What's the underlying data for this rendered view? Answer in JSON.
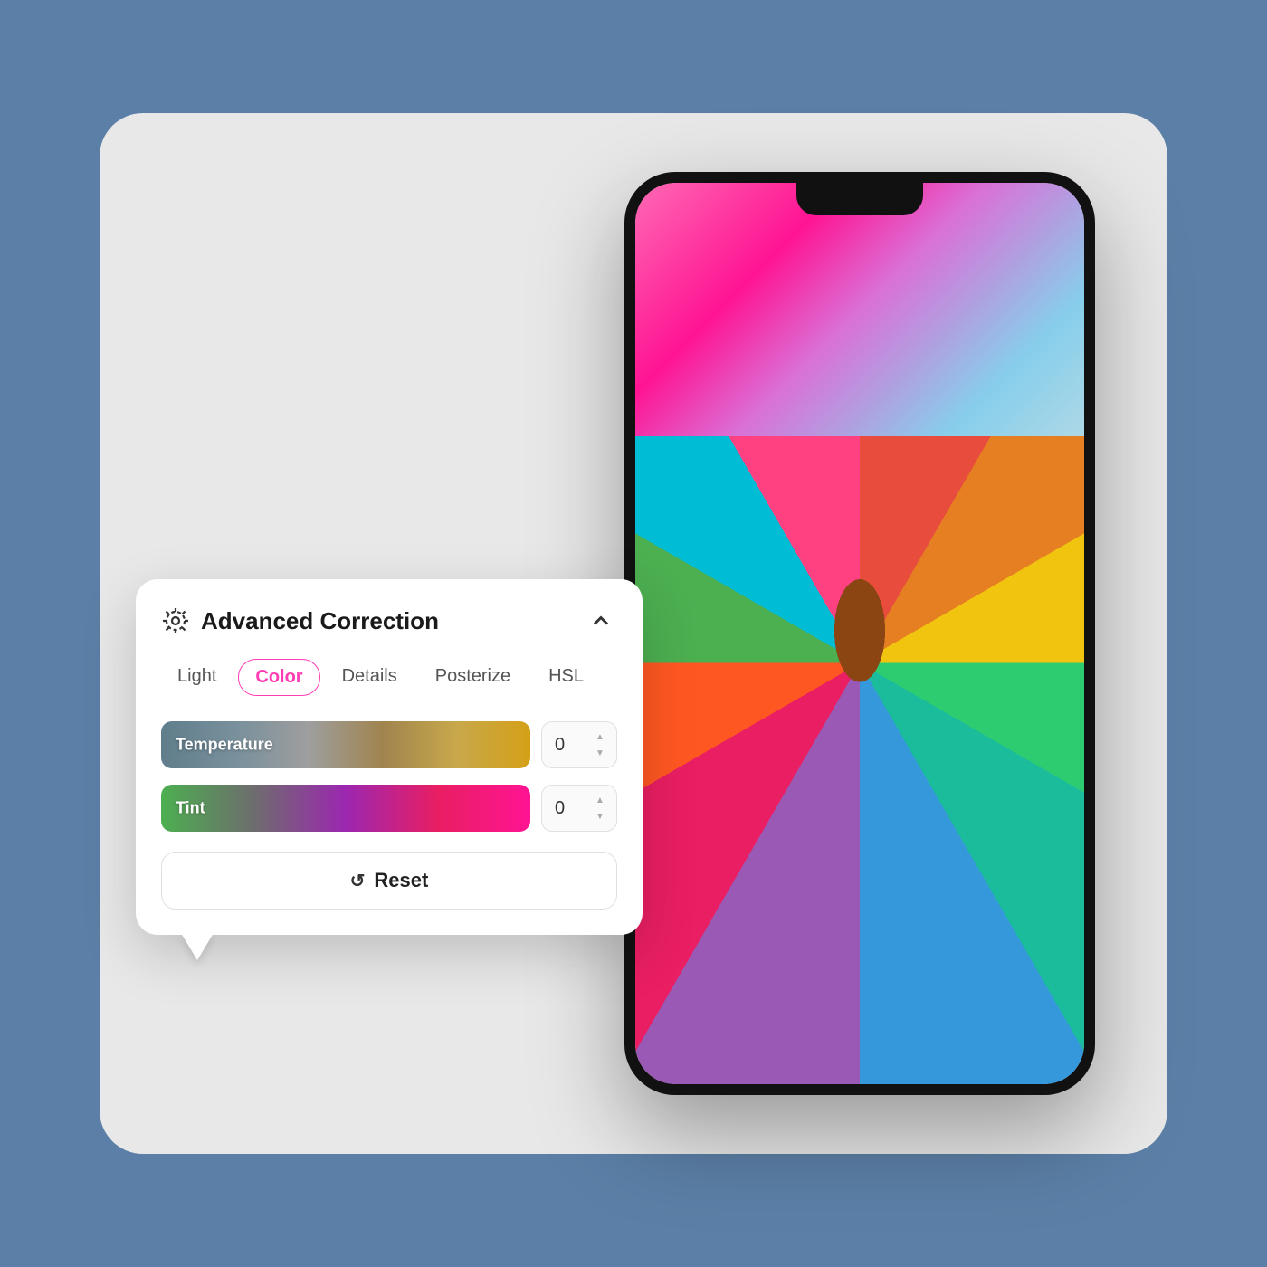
{
  "background": {
    "color": "#5b7fa6"
  },
  "panel": {
    "title": "Advanced Correction",
    "icon_label": "gear-icon",
    "collapse_icon": "chevron-up-icon",
    "tabs": [
      {
        "id": "light",
        "label": "Light",
        "active": false
      },
      {
        "id": "color",
        "label": "Color",
        "active": true
      },
      {
        "id": "details",
        "label": "Details",
        "active": false
      },
      {
        "id": "posterize",
        "label": "Posterize",
        "active": false
      },
      {
        "id": "hsl",
        "label": "HSL",
        "active": false
      }
    ],
    "sliders": [
      {
        "id": "temperature",
        "label": "Temperature",
        "value": "0",
        "type": "temperature"
      },
      {
        "id": "tint",
        "label": "Tint",
        "value": "0",
        "type": "tint"
      }
    ],
    "reset_button": {
      "label": "Reset",
      "icon": "reset-icon"
    }
  }
}
